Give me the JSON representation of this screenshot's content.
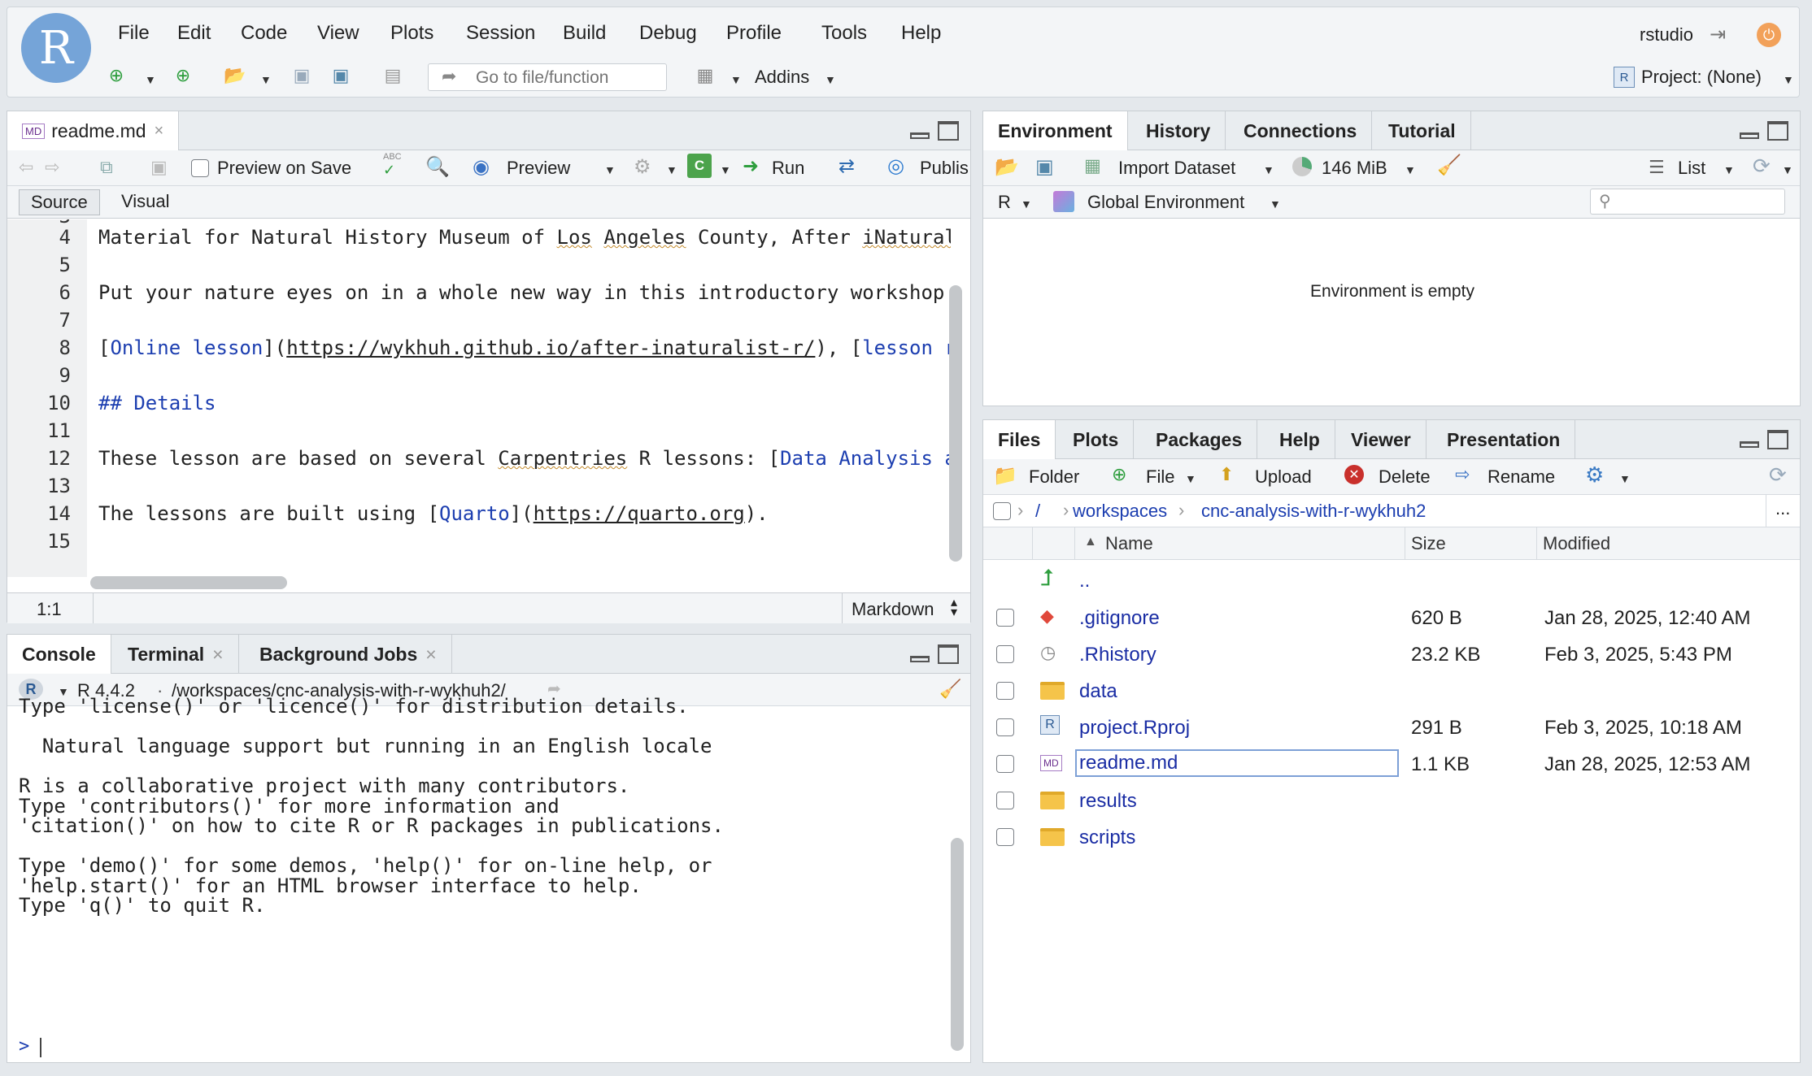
{
  "app": {
    "user": "rstudio",
    "project": "Project: (None)",
    "logo_letter": "R"
  },
  "menu": [
    "File",
    "Edit",
    "Code",
    "View",
    "Plots",
    "Session",
    "Build",
    "Debug",
    "Profile",
    "Tools",
    "Help"
  ],
  "toolbar": {
    "goto_placeholder": "Go to file/function",
    "addins": "Addins"
  },
  "editor": {
    "tab": "readme.md",
    "file_badge": "MD",
    "preview_on_save": "Preview on Save",
    "preview": "Preview",
    "run": "Run",
    "publish": "Publis",
    "mode_source": "Source",
    "mode_visual": "Visual",
    "status_pos": "1:1",
    "status_lang": "Markdown",
    "lines": [
      {
        "n": "4",
        "segs": [
          {
            "t": "Material for Natural History Museum of "
          },
          {
            "t": "Los",
            "c": "u"
          },
          {
            "t": " "
          },
          {
            "t": "Angeles",
            "c": "u"
          },
          {
            "t": " County, After "
          },
          {
            "t": "iNatural",
            "c": "u"
          }
        ]
      },
      {
        "n": "5",
        "segs": []
      },
      {
        "n": "6",
        "segs": [
          {
            "t": "Put your nature eyes on in a whole new way in this introductory workshop"
          }
        ]
      },
      {
        "n": "7",
        "segs": []
      },
      {
        "n": "8",
        "segs": [
          {
            "t": "["
          },
          {
            "t": "Online lesson",
            "c": "link"
          },
          {
            "t": "]("
          },
          {
            "t": "https://wykhuh.github.io/after-inaturalist-r/",
            "c": "urlu"
          },
          {
            "t": "), ["
          },
          {
            "t": "lesson r",
            "c": "link"
          }
        ]
      },
      {
        "n": "9",
        "segs": []
      },
      {
        "n": "10",
        "segs": [
          {
            "t": "## Details",
            "c": "link"
          }
        ]
      },
      {
        "n": "11",
        "segs": []
      },
      {
        "n": "12",
        "segs": [
          {
            "t": "These lesson are based on several "
          },
          {
            "t": "Carpentries",
            "c": "u"
          },
          {
            "t": " R lessons: ["
          },
          {
            "t": "Data Analysis a",
            "c": "link"
          }
        ]
      },
      {
        "n": "13",
        "segs": []
      },
      {
        "n": "14",
        "segs": [
          {
            "t": "The lessons are built using ["
          },
          {
            "t": "Quarto",
            "c": "link"
          },
          {
            "t": "]("
          },
          {
            "t": "https://quarto.org",
            "c": "urlu"
          },
          {
            "t": ")."
          }
        ]
      },
      {
        "n": "15",
        "segs": []
      }
    ]
  },
  "console": {
    "tabs": [
      "Console",
      "Terminal",
      "Background Jobs"
    ],
    "r_version": "R 4.4.2",
    "path": "/workspaces/cnc-analysis-with-r-wykhuh2/",
    "output": [
      "Type 'license()' or 'licence()' for distribution details.",
      "",
      "  Natural language support but running in an English locale",
      "",
      "R is a collaborative project with many contributors.",
      "Type 'contributors()' for more information and",
      "'citation()' on how to cite R or R packages in publications.",
      "",
      "Type 'demo()' for some demos, 'help()' for on-line help, or",
      "'help.start()' for an HTML browser interface to help.",
      "Type 'q()' to quit R."
    ],
    "prompt": ">"
  },
  "environment": {
    "tabs": [
      "Environment",
      "History",
      "Connections",
      "Tutorial"
    ],
    "import_dataset": "Import Dataset",
    "memory": "146 MiB",
    "view_mode": "List",
    "language": "R",
    "scope": "Global Environment",
    "empty_msg": "Environment is empty"
  },
  "files": {
    "tabs": [
      "Files",
      "Plots",
      "Packages",
      "Help",
      "Viewer",
      "Presentation"
    ],
    "actions": {
      "folder": "Folder",
      "file": "File",
      "upload": "Upload",
      "delete": "Delete",
      "rename": "Rename"
    },
    "breadcrumb": {
      "root": "/",
      "parts": [
        "workspaces",
        "cnc-analysis-with-r-wykhuh2"
      ]
    },
    "more": "...",
    "headers": {
      "name": "Name",
      "size": "Size",
      "modified": "Modified"
    },
    "up": "..",
    "rows": [
      {
        "name": ".gitignore",
        "size": "620 B",
        "modified": "Jan 28, 2025, 12:40 AM",
        "icon": "git-icon"
      },
      {
        "name": ".Rhistory",
        "size": "23.2 KB",
        "modified": "Feb 3, 2025, 5:43 PM",
        "icon": "history-icon"
      },
      {
        "name": "data",
        "size": "",
        "modified": "",
        "icon": "folder-icon"
      },
      {
        "name": "project.Rproj",
        "size": "291 B",
        "modified": "Feb 3, 2025, 10:18 AM",
        "icon": "rproj-icon"
      },
      {
        "name": "readme.md",
        "size": "1.1 KB",
        "modified": "Jan 28, 2025, 12:53 AM",
        "icon": "md-icon",
        "selected": true
      },
      {
        "name": "results",
        "size": "",
        "modified": "",
        "icon": "folder-icon"
      },
      {
        "name": "scripts",
        "size": "",
        "modified": "",
        "icon": "folder-icon"
      }
    ]
  },
  "colors": {
    "accent": "#75a4d8",
    "link": "#1c3eb0",
    "folder": "#f5c44a"
  }
}
